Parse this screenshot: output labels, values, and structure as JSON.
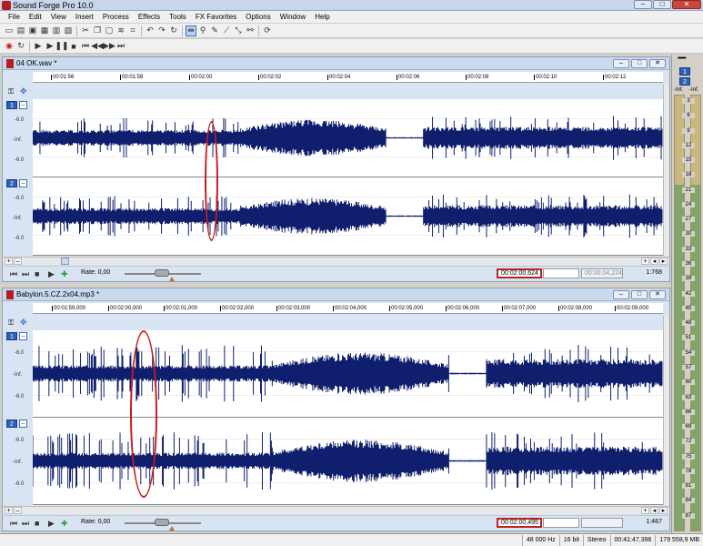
{
  "app": {
    "title": "Sound Forge Pro 10.0"
  },
  "menu": [
    "File",
    "Edit",
    "View",
    "Insert",
    "Process",
    "Effects",
    "Tools",
    "FX Favorites",
    "Options",
    "Window",
    "Help"
  ],
  "window_buttons": {
    "minimize": "–",
    "maximize": "□",
    "close": "✕"
  },
  "toolbar1": [
    "new-icon",
    "open-icon",
    "save-icon",
    "save-all-icon",
    "print-icon",
    "properties-icon",
    "cut-icon",
    "copy-icon",
    "paste-icon",
    "mix-icon",
    "crop-icon",
    "undo-icon",
    "redo-icon",
    "repeat-icon",
    "edit-tool-icon",
    "magnify-tool-icon",
    "pencil-tool-icon",
    "envelope-tool-icon",
    "event-tool-icon",
    "snap-icon",
    "refresh-icon"
  ],
  "toolbar2": [
    "record-icon",
    "loop-icon",
    "play-all-icon",
    "play-icon",
    "pause-icon",
    "stop-icon",
    "go-start-icon",
    "rewind-icon",
    "forward-icon",
    "go-end-icon"
  ],
  "documents": [
    {
      "title": "04 OK.wav *",
      "ruler": [
        "00:01:56",
        "00:01:58",
        "00:02:00",
        "00:02:02",
        "00:02:04",
        "00:02:06",
        "00:02:08",
        "00:02:10",
        "00:02:12"
      ],
      "channels": [
        {
          "badge": "1",
          "labels": [
            "-6.0",
            "-Inf.",
            "-6.0"
          ]
        },
        {
          "badge": "2",
          "labels": [
            "-6.0",
            "-Inf.",
            "-6.0"
          ]
        }
      ],
      "rate_label": "Rate: 0,00",
      "cursor_time": "00:02:00,624",
      "selection_length": "00:00:04,224",
      "zoom": "1:768"
    },
    {
      "title": "Babylon.5.CZ.2x04.mp3 *",
      "ruler": [
        "00:01:59,000",
        "00:02:00,000",
        "00:02:01,000",
        "00:02:02,000",
        "00:02:03,000",
        "00:02:04,000",
        "00:02:05,000",
        "00:02:06,000",
        "00:02:07,000",
        "00:02:08,000",
        "00:02:09,000"
      ],
      "channels": [
        {
          "badge": "1",
          "labels": [
            "-6.0",
            "-Inf.",
            "-6.0"
          ]
        },
        {
          "badge": "2",
          "labels": [
            "-6.0",
            "-Inf.",
            "-6.0"
          ]
        }
      ],
      "rate_label": "Rate: 0,00",
      "cursor_time": "00:02:00,495",
      "selection_length": "",
      "zoom": "1:467"
    }
  ],
  "meter": {
    "dots": "••••••",
    "badges": [
      "1",
      "2"
    ],
    "inf_left": "-Inf.",
    "inf_right": "-Inf.",
    "scale": [
      "3",
      "6",
      "9",
      "12",
      "15",
      "18",
      "21",
      "24",
      "27",
      "30",
      "33",
      "36",
      "39",
      "42",
      "45",
      "48",
      "51",
      "54",
      "57",
      "60",
      "63",
      "66",
      "69",
      "72",
      "75",
      "78",
      "81",
      "84",
      "87"
    ]
  },
  "status": [
    "48 000 Hz",
    "16 bit",
    "Stereo",
    "00:41:47,396",
    "179 558,9 MB"
  ],
  "colors": {
    "waveform": "#0f1f6e",
    "annotation": "#c81d1d",
    "accent": "#2f5fb8"
  }
}
